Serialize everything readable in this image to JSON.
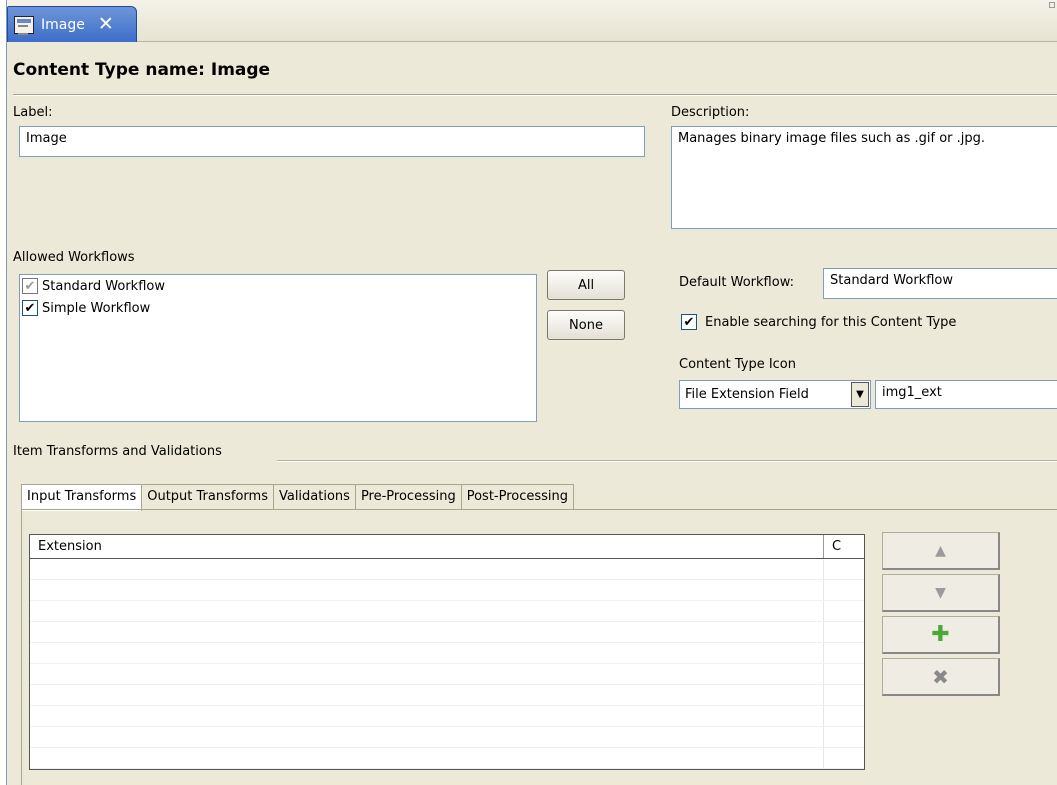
{
  "tab": {
    "label": "Image",
    "close": "✕"
  },
  "title": "Content Type name: Image",
  "label": {
    "caption": "Label:",
    "value": "Image"
  },
  "description": {
    "caption": "Description:",
    "value": "Manages binary image files such as .gif or .jpg."
  },
  "allowed_workflows": {
    "caption": "Allowed Workflows",
    "items": [
      {
        "label": "Standard Workflow",
        "checked": true,
        "dimmed": true
      },
      {
        "label": "Simple Workflow",
        "checked": true,
        "dimmed": false
      }
    ],
    "all_button": "All",
    "none_button": "None"
  },
  "default_workflow": {
    "caption": "Default Workflow:",
    "value": "Standard Workflow"
  },
  "enable_search": {
    "label": "Enable searching for this Content Type",
    "checked": true
  },
  "content_type_icon": {
    "caption": "Content Type Icon",
    "select_value": "File Extension Field",
    "field_value": "img1_ext"
  },
  "section_title": "Item Transforms and Validations",
  "tabs": [
    "Input Transforms",
    "Output Transforms",
    "Validations",
    "Pre-Processing",
    "Post-Processing"
  ],
  "active_tab": "Input Transforms",
  "table": {
    "columns": [
      "Extension",
      "C"
    ],
    "rows": []
  },
  "side_buttons": {
    "up": "▲",
    "down": "▼",
    "add": "✚",
    "remove": "✖"
  }
}
